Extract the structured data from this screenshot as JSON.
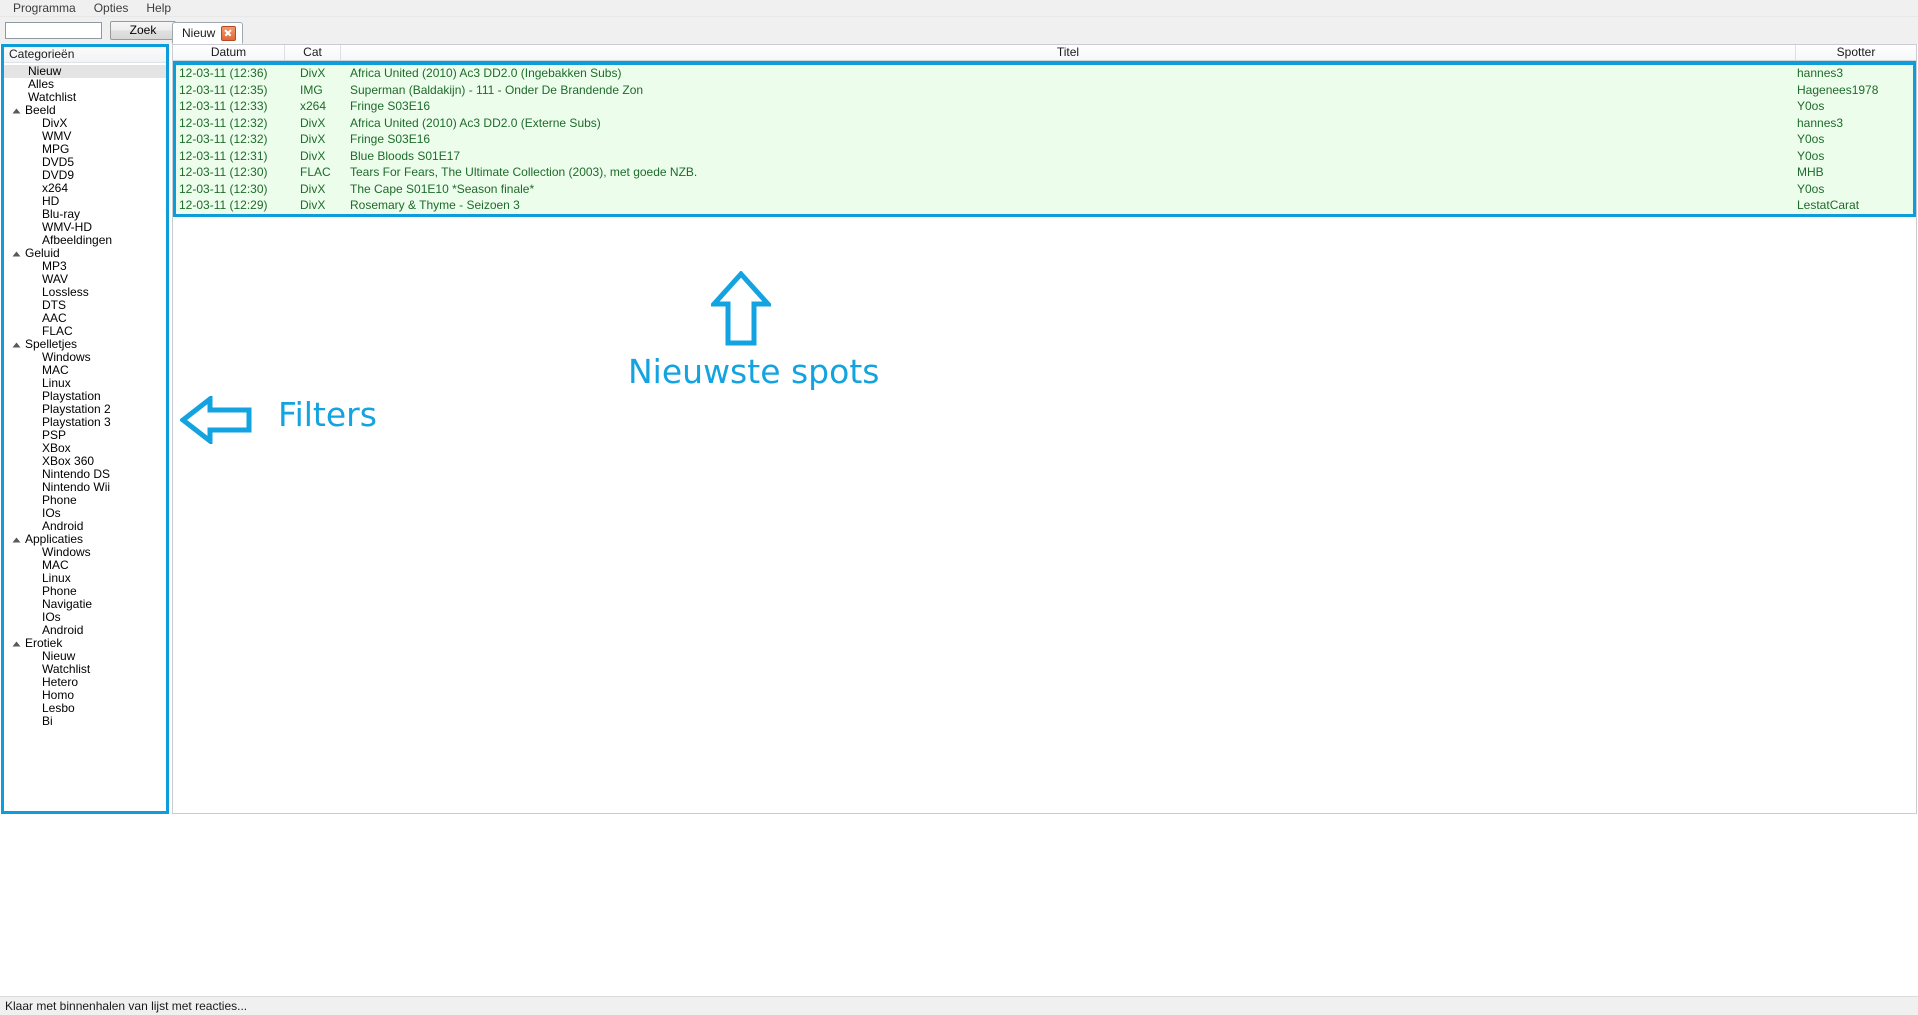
{
  "menubar": {
    "items": [
      {
        "label": "Programma"
      },
      {
        "label": "Opties"
      },
      {
        "label": "Help"
      }
    ]
  },
  "toolbar": {
    "search_value": "",
    "search_placeholder": "",
    "zoek_label": "Zoek"
  },
  "tabs": [
    {
      "label": "Nieuw",
      "close_icon": "close-icon",
      "active": true
    }
  ],
  "sidebar": {
    "header": "Categorieën",
    "accent_color": "#0d9ddb",
    "items": [
      {
        "label": "Nieuw",
        "level": "root",
        "selected": true
      },
      {
        "label": "Alles",
        "level": "root",
        "selected": false
      },
      {
        "label": "Watchlist",
        "level": "root",
        "selected": false
      },
      {
        "label": "Beeld",
        "level": "group",
        "expanded": true
      },
      {
        "label": "DivX",
        "level": "child"
      },
      {
        "label": "WMV",
        "level": "child"
      },
      {
        "label": "MPG",
        "level": "child"
      },
      {
        "label": "DVD5",
        "level": "child"
      },
      {
        "label": "DVD9",
        "level": "child"
      },
      {
        "label": "x264",
        "level": "child"
      },
      {
        "label": "HD",
        "level": "child"
      },
      {
        "label": "Blu-ray",
        "level": "child"
      },
      {
        "label": "WMV-HD",
        "level": "child"
      },
      {
        "label": "Afbeeldingen",
        "level": "child"
      },
      {
        "label": "Geluid",
        "level": "group",
        "expanded": true
      },
      {
        "label": "MP3",
        "level": "child"
      },
      {
        "label": "WAV",
        "level": "child"
      },
      {
        "label": "Lossless",
        "level": "child"
      },
      {
        "label": "DTS",
        "level": "child"
      },
      {
        "label": "AAC",
        "level": "child"
      },
      {
        "label": "FLAC",
        "level": "child"
      },
      {
        "label": "Spelletjes",
        "level": "group",
        "expanded": true
      },
      {
        "label": "Windows",
        "level": "child"
      },
      {
        "label": "MAC",
        "level": "child"
      },
      {
        "label": "Linux",
        "level": "child"
      },
      {
        "label": "Playstation",
        "level": "child"
      },
      {
        "label": "Playstation 2",
        "level": "child"
      },
      {
        "label": "Playstation 3",
        "level": "child"
      },
      {
        "label": "PSP",
        "level": "child"
      },
      {
        "label": "XBox",
        "level": "child"
      },
      {
        "label": "XBox 360",
        "level": "child"
      },
      {
        "label": "Nintendo DS",
        "level": "child"
      },
      {
        "label": "Nintendo Wii",
        "level": "child"
      },
      {
        "label": "Phone",
        "level": "child"
      },
      {
        "label": "IOs",
        "level": "child"
      },
      {
        "label": "Android",
        "level": "child"
      },
      {
        "label": "Applicaties",
        "level": "group",
        "expanded": true
      },
      {
        "label": "Windows",
        "level": "child"
      },
      {
        "label": "MAC",
        "level": "child"
      },
      {
        "label": "Linux",
        "level": "child"
      },
      {
        "label": "Phone",
        "level": "child"
      },
      {
        "label": "Navigatie",
        "level": "child"
      },
      {
        "label": "IOs",
        "level": "child"
      },
      {
        "label": "Android",
        "level": "child"
      },
      {
        "label": "Erotiek",
        "level": "group",
        "expanded": true
      },
      {
        "label": "Nieuw",
        "level": "child"
      },
      {
        "label": "Watchlist",
        "level": "child"
      },
      {
        "label": "Hetero",
        "level": "child"
      },
      {
        "label": "Homo",
        "level": "child"
      },
      {
        "label": "Lesbo",
        "level": "child"
      },
      {
        "label": "Bi",
        "level": "child"
      }
    ]
  },
  "list": {
    "columns": [
      {
        "key": "datum",
        "label": "Datum"
      },
      {
        "key": "cat",
        "label": "Cat"
      },
      {
        "key": "titel",
        "label": "Titel"
      },
      {
        "key": "spotter",
        "label": "Spotter"
      }
    ],
    "rows": [
      {
        "datum": "12-03-11 (12:36)",
        "cat": "DivX",
        "titel": "Africa United (2010) Ac3 DD2.0 (Ingebakken Subs)",
        "spotter": "hannes3"
      },
      {
        "datum": "12-03-11 (12:35)",
        "cat": "IMG",
        "titel": "Superman (Baldakijn) - 111 - Onder De Brandende Zon",
        "spotter": "Hagenees1978"
      },
      {
        "datum": "12-03-11 (12:33)",
        "cat": "x264",
        "titel": "Fringe S03E16",
        "spotter": "Y0os"
      },
      {
        "datum": "12-03-11 (12:32)",
        "cat": "DivX",
        "titel": "Africa United (2010) Ac3 DD2.0 (Externe Subs)",
        "spotter": "hannes3"
      },
      {
        "datum": "12-03-11 (12:32)",
        "cat": "DivX",
        "titel": "Fringe S03E16",
        "spotter": "Y0os"
      },
      {
        "datum": "12-03-11 (12:31)",
        "cat": "DivX",
        "titel": "Blue Bloods S01E17",
        "spotter": "Y0os"
      },
      {
        "datum": "12-03-11 (12:30)",
        "cat": "FLAC",
        "titel": "Tears For Fears, The Ultimate Collection (2003), met goede NZB.",
        "spotter": "MHB"
      },
      {
        "datum": "12-03-11 (12:30)",
        "cat": "DivX",
        "titel": "The Cape S01E10 *Season finale*",
        "spotter": "Y0os"
      },
      {
        "datum": "12-03-11 (12:29)",
        "cat": "DivX",
        "titel": "Rosemary & Thyme - Seizoen 3",
        "spotter": "LestatCarat"
      }
    ]
  },
  "annotations": {
    "color": "#13a3e0",
    "newest_spots_label": "Nieuwste spots",
    "filters_label": "Filters",
    "up_arrow_icon": "arrow-up-icon",
    "left_arrow_icon": "arrow-left-icon"
  },
  "statusbar": {
    "message": "Klaar met binnenhalen van lijst met reacties..."
  }
}
